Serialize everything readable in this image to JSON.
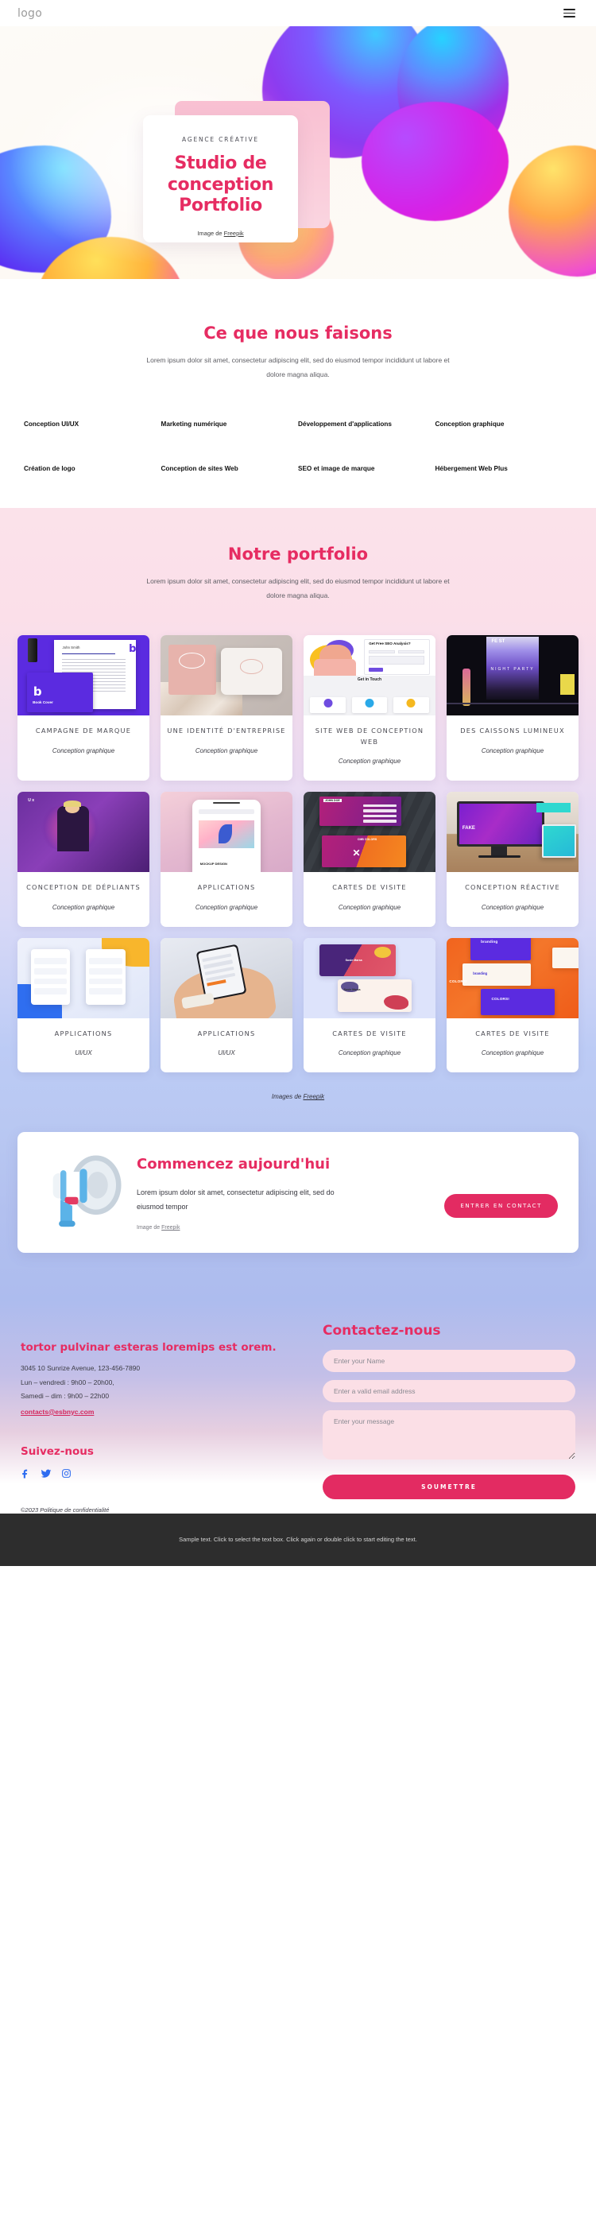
{
  "header": {
    "logo": "logo",
    "menu_icon": "hamburger-menu-icon"
  },
  "hero": {
    "eyebrow": "AGENCE CRÉATIVE",
    "title": "Studio de conception Portfolio",
    "credit_prefix": "Image de ",
    "credit_link": "Freepik"
  },
  "whatwedo": {
    "title": "Ce que nous faisons",
    "subtitle": "Lorem ipsum dolor sit amet, consectetur adipiscing elit, sed do eiusmod tempor incididunt ut labore et dolore magna aliqua.",
    "services": [
      "Conception UI/UX",
      "Marketing numérique",
      "Développement d'applications",
      "Conception graphique",
      "Création de logo",
      "Conception de sites Web",
      "SEO et image de marque",
      "Hébergement Web Plus"
    ]
  },
  "portfolio": {
    "title": "Notre portfolio",
    "subtitle": "Lorem ipsum dolor sit amet, consectetur adipiscing elit, sed do eiusmod tempor incididunt ut labore et dolore magna aliqua.",
    "credit_prefix": "Images de ",
    "credit_link": "Freepik",
    "items": [
      {
        "name": "CAMPAGNE DE MARQUE",
        "category": "Conception graphique"
      },
      {
        "name": "UNE IDENTITÉ D'ENTREPRISE",
        "category": "Conception graphique"
      },
      {
        "name": "SITE WEB DE CONCEPTION WEB",
        "category": "Conception graphique"
      },
      {
        "name": "DES CAISSONS LUMINEUX",
        "category": "Conception graphique"
      },
      {
        "name": "CONCEPTION DE DÉPLIANTS",
        "category": "Conception graphique"
      },
      {
        "name": "APPLICATIONS",
        "category": "Conception graphique"
      },
      {
        "name": "CARTES DE VISITE",
        "category": "Conception graphique"
      },
      {
        "name": "CONCEPTION RÉACTIVE",
        "category": "Conception graphique"
      },
      {
        "name": "APPLICATIONS",
        "category": "UI/UX"
      },
      {
        "name": "APPLICATIONS",
        "category": "UI/UX"
      },
      {
        "name": "CARTES DE VISITE",
        "category": "Conception graphique"
      },
      {
        "name": "CARTES DE VISITE",
        "category": "Conception graphique"
      }
    ],
    "thumb_texts": {
      "card1_name": "John Smith",
      "card1_cover": "Book Cover",
      "card1_mark": "b",
      "card3_heading": "Get Free SEO Analysis?",
      "card3_git": "Get in Touch",
      "card4_fest": "FE ST",
      "card4_night": "NIGHT PARTY",
      "card5_ux": "U x",
      "card6_mockup": "MOCKUP DESIGN",
      "card7_name": "JOHN DOE",
      "card7_role": "DESIGNER",
      "card7_colors": "CMB COLORS",
      "card8_fake": "FAKE",
      "card8_news": "NEWS",
      "card11_name": "Susie Marsa",
      "card12_colors": "COLORS!",
      "card12_branding": "branding"
    }
  },
  "cta": {
    "title": "Commencez aujourd'hui",
    "desc": "Lorem ipsum dolor sit amet, consectetur adipiscing elit, sed do eiusmod tempor",
    "credit_prefix": "Image de ",
    "credit_link": "Freepik",
    "button": "ENTRER EN CONTACT",
    "icon": "megaphone-icon"
  },
  "footer": {
    "headline": "tortor pulvinar esteras loremips est orem.",
    "address": "3045 10 Sunrize Avenue, 123-456-7890",
    "hours_line1": "Lun – vendredi : 9h00 – 20h00,",
    "hours_line2": "Samedi – dim : 9h00 – 22h00",
    "email": "contacts@esbnyc.com",
    "follow_title": "Suivez-nous",
    "socials": [
      "facebook-icon",
      "twitter-icon",
      "instagram-icon"
    ],
    "copyright": "©2023 Politique de confidentialité",
    "form": {
      "title": "Contactez-nous",
      "name_placeholder": "Enter your Name",
      "email_placeholder": "Enter a valid email address",
      "message_placeholder": "Enter your message",
      "submit_label": "SOUMETTRE"
    }
  },
  "bottom_bar": {
    "text": "Sample text. Click to select the text box. Click again or double click to start editing the text."
  },
  "colors": {
    "accent_pink": "#e62c62",
    "button_pink": "#e32b62",
    "field_pink": "#fbdfe6",
    "dark_bar": "#2d2d2d",
    "social_blue": "#2f6df0"
  }
}
